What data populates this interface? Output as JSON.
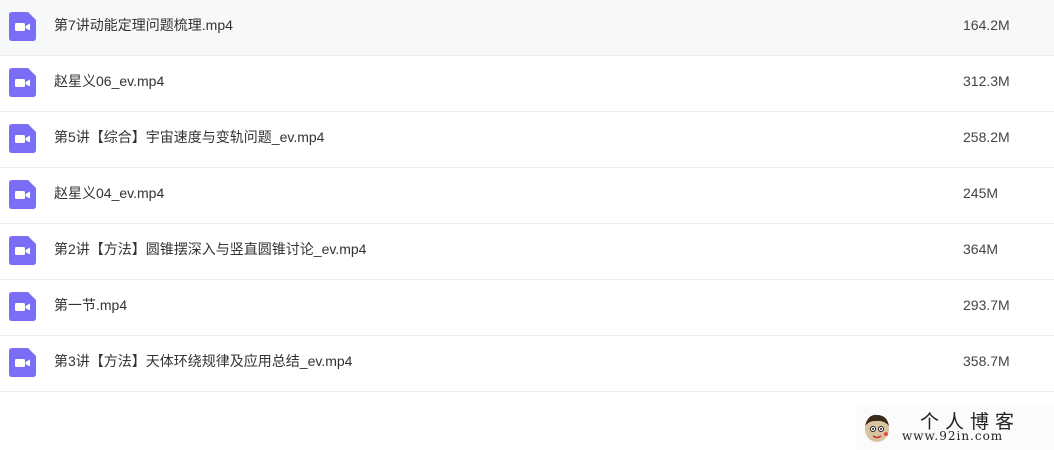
{
  "files": [
    {
      "name": "第7讲动能定理问题梳理.mp4",
      "size": "164.2M",
      "icon": "video-file-icon"
    },
    {
      "name": "赵星义06_ev.mp4",
      "size": "312.3M",
      "icon": "video-file-icon"
    },
    {
      "name": "第5讲【综合】宇宙速度与变轨问题_ev.mp4",
      "size": "258.2M",
      "icon": "video-file-icon"
    },
    {
      "name": "赵星义04_ev.mp4",
      "size": "245M",
      "icon": "video-file-icon"
    },
    {
      "name": "第2讲【方法】圆锥摆深入与竖直圆锥讨论_ev.mp4",
      "size": "364M",
      "icon": "video-file-icon"
    },
    {
      "name": "第一节.mp4",
      "size": "293.7M",
      "icon": "video-file-icon"
    },
    {
      "name": "第3讲【方法】天体环绕规律及应用总结_ev.mp4",
      "size": "358.7M",
      "icon": "video-file-icon"
    }
  ],
  "watermark": {
    "title": "个人博客",
    "url": "www.92in.com"
  },
  "colors": {
    "icon_purple": "#7b6ef6",
    "divider": "#eeeeee"
  }
}
